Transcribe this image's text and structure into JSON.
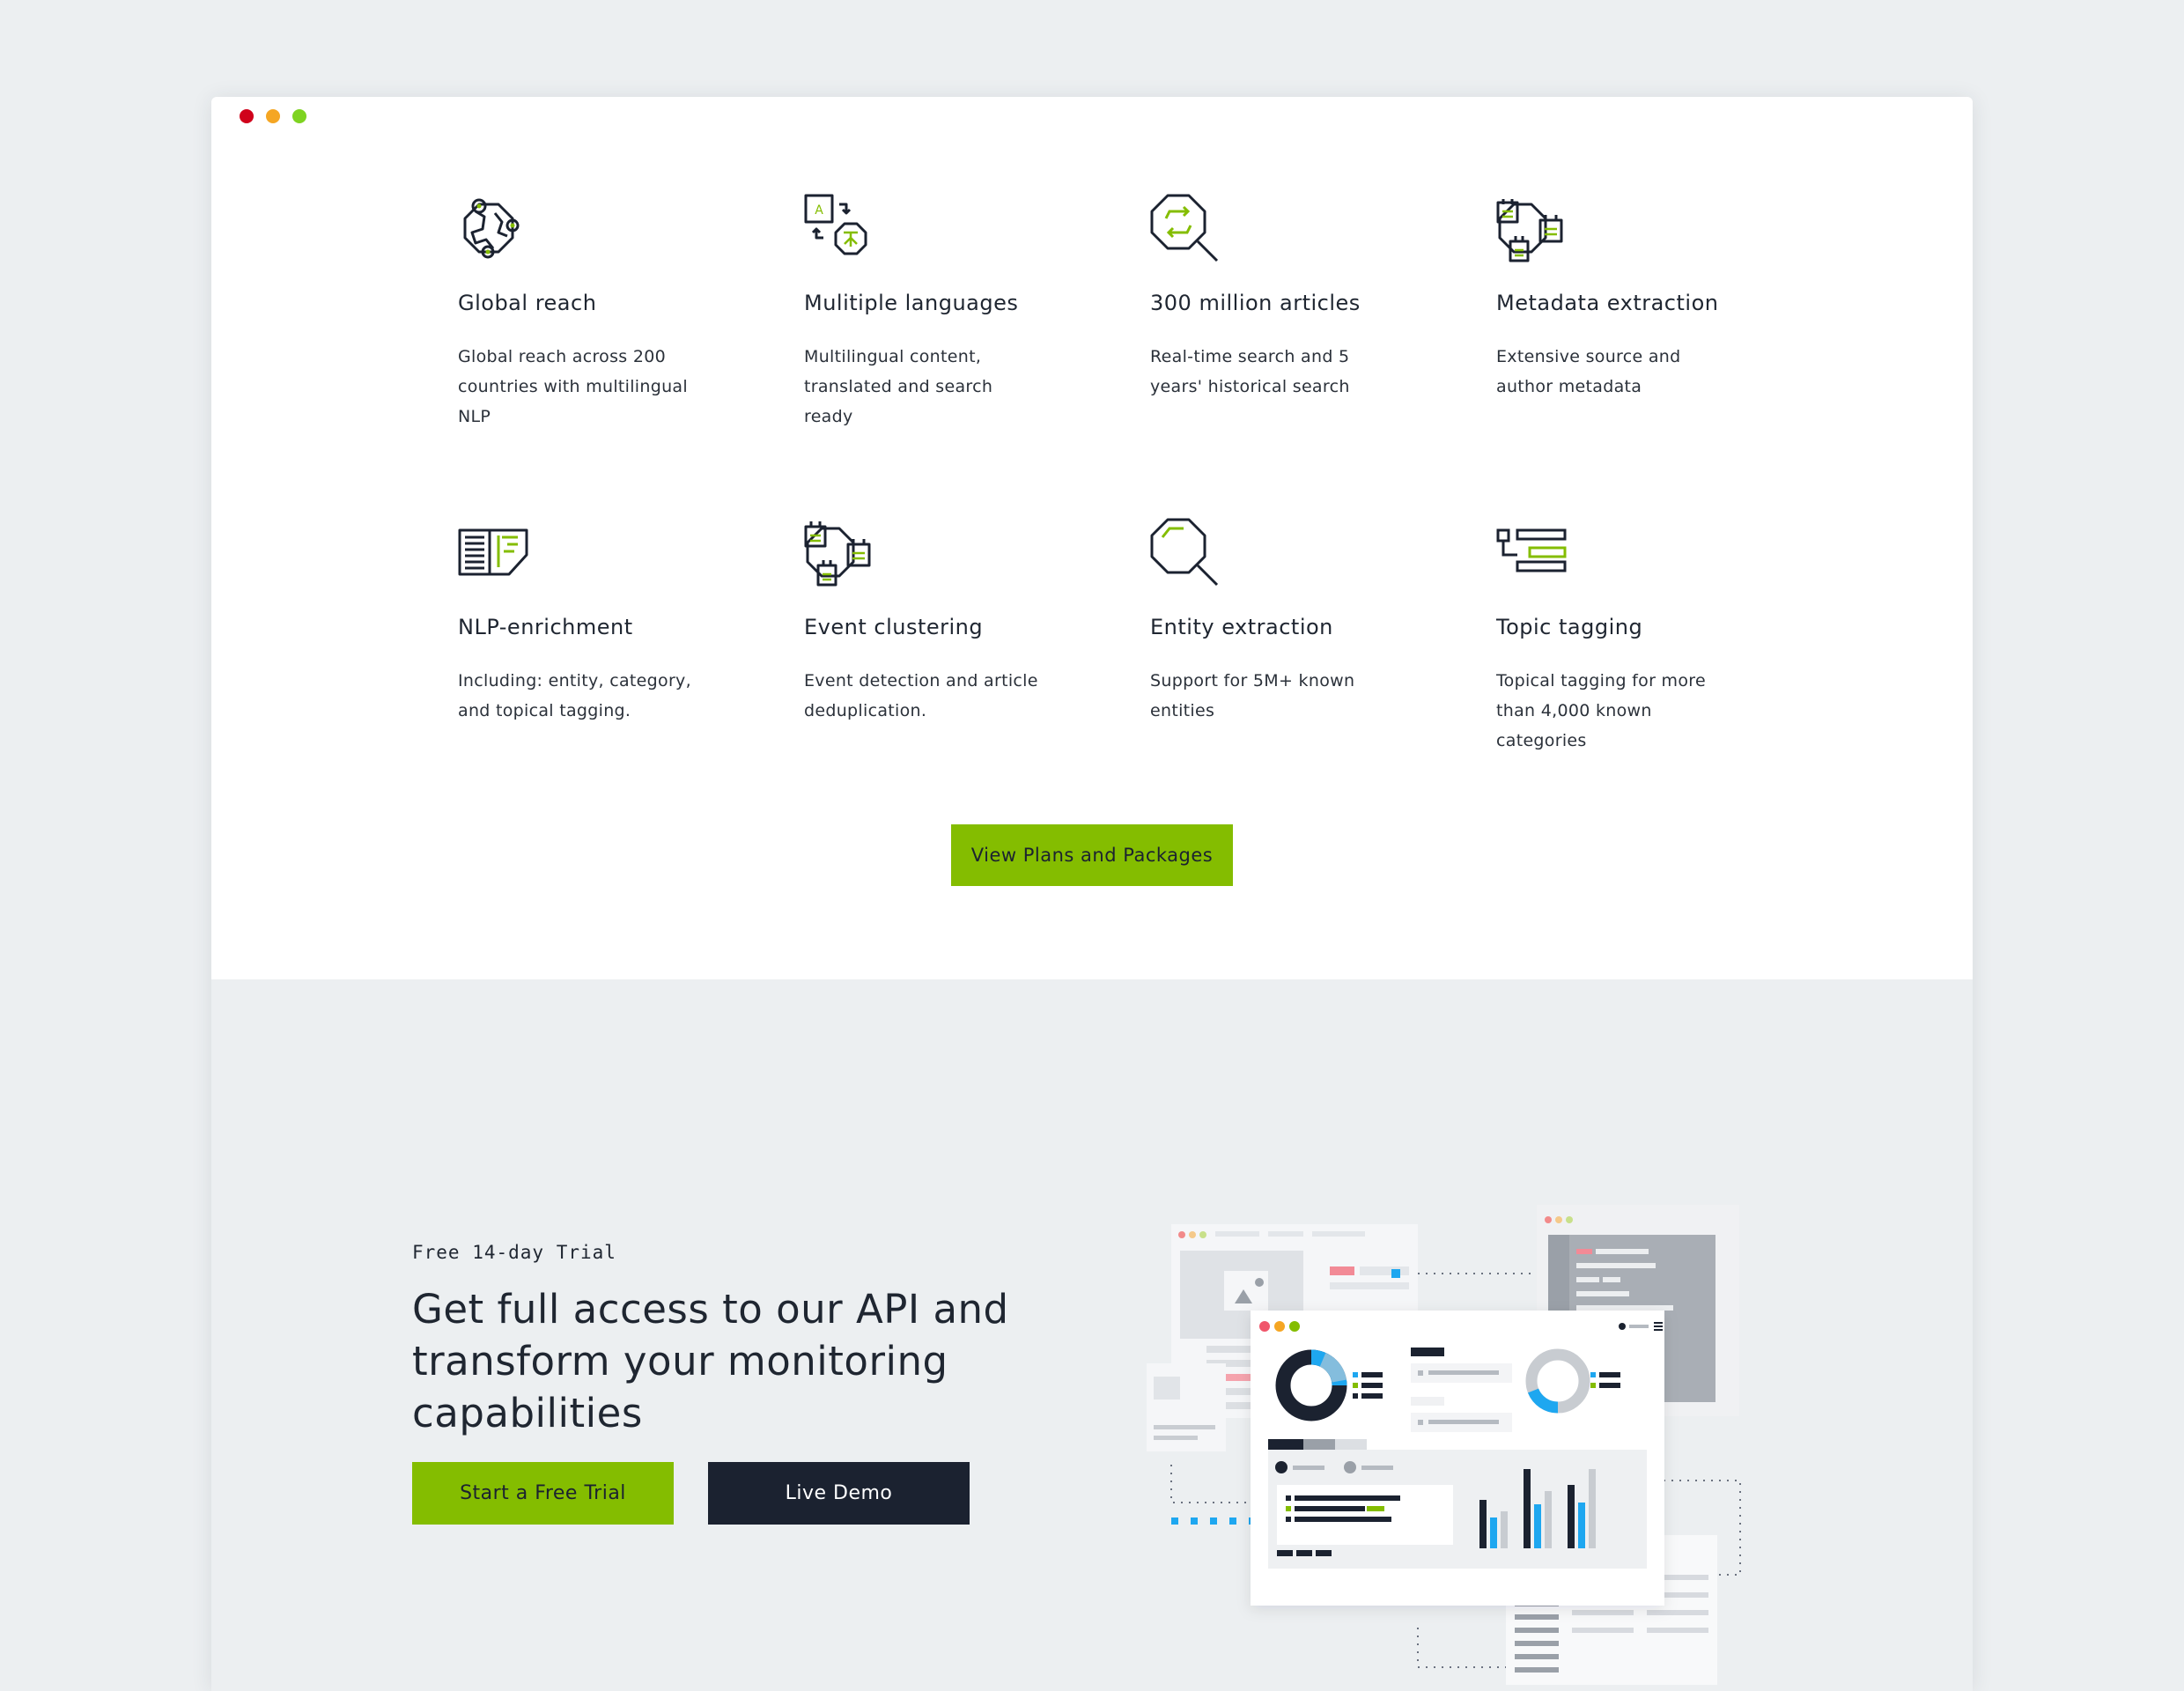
{
  "window": {
    "controls": [
      {
        "name": "close",
        "color": "#d0021b"
      },
      {
        "name": "minimize",
        "color": "#f5a623"
      },
      {
        "name": "maximize",
        "color": "#7ed321"
      }
    ]
  },
  "features": [
    {
      "icon": "globe-icon",
      "title": "Global reach",
      "description": "Global reach across 200 countries with multilingual NLP"
    },
    {
      "icon": "translate-icon",
      "title": "Mulitiple languages",
      "description": "Multilingual content, translated and search ready"
    },
    {
      "icon": "search-refresh-icon",
      "title": "300 million articles",
      "description": "Real-time search and 5 years' historical search"
    },
    {
      "icon": "metadata-icon",
      "title": "Metadata extraction",
      "description": "Extensive source and author metadata"
    },
    {
      "icon": "document-enrichment-icon",
      "title": "NLP-enrichment",
      "description": "Including: entity, category, and topical tagging."
    },
    {
      "icon": "cluster-icon",
      "title": "Event clustering",
      "description": "Event detection and article deduplication."
    },
    {
      "icon": "magnifier-icon",
      "title": "Entity extraction",
      "description": "Support for 5M+ known entities"
    },
    {
      "icon": "tag-tree-icon",
      "title": "Topic tagging",
      "description": "Topical tagging for more than 4,000 known categories"
    }
  ],
  "plans_button": {
    "label": "View Plans and Packages"
  },
  "trial": {
    "eyebrow": "Free 14-day Trial",
    "headline": "Get full access to our API and transform your monitoring capabilities",
    "primary_button": "Start a Free Trial",
    "secondary_button": "Live Demo"
  },
  "colors": {
    "accent_green": "#84bd00",
    "dark_navy": "#1b2230",
    "section_gray": "#eceff1",
    "chart_blue": "#1ea7f0"
  }
}
